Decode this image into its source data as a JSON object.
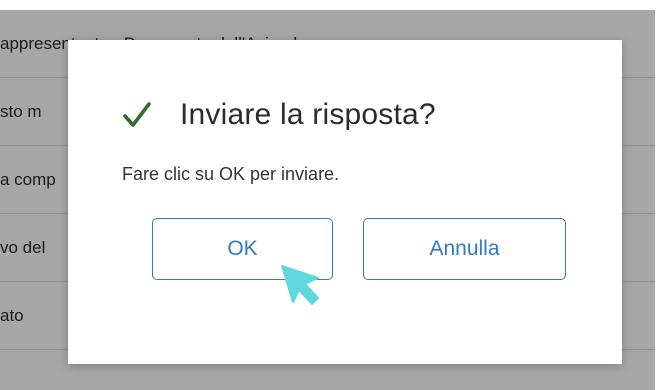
{
  "background": {
    "rows": [
      "appresentante - Documento dell'Azienda",
      "sto m",
      "a comp",
      "vo del",
      "ato"
    ]
  },
  "dialog": {
    "icon": "checkmark-icon",
    "title": "Inviare la risposta?",
    "message": "Fare clic su OK per inviare.",
    "ok_label": "OK",
    "cancel_label": "Annulla"
  },
  "colors": {
    "accent": "#2f79c5",
    "check": "#2d6e2e",
    "cursor": "#5fd8dd"
  }
}
